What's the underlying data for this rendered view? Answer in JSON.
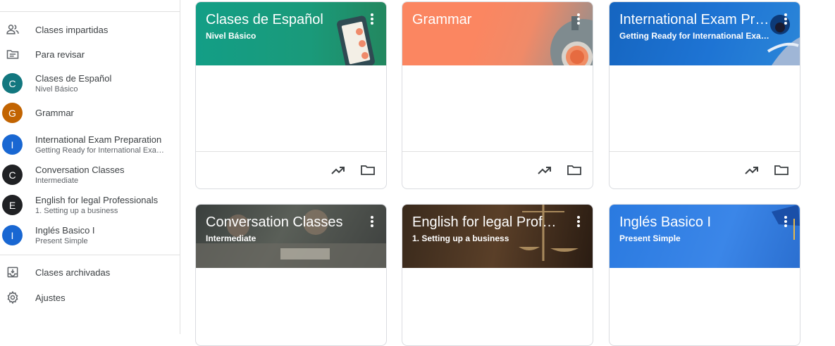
{
  "sidebar": {
    "nav_top": [
      {
        "label": "Clases impartidas",
        "icon": "people-icon"
      },
      {
        "label": "Para revisar",
        "icon": "review-folder-icon"
      }
    ],
    "courses": [
      {
        "initial": "C",
        "name": "Clases de Español",
        "section": "Nivel Básico",
        "color": "#12777f"
      },
      {
        "initial": "G",
        "name": "Grammar",
        "section": "",
        "color": "#c26401"
      },
      {
        "initial": "I",
        "name": "International Exam Preparation",
        "section": "Getting Ready for International Exams!",
        "color": "#1967d2"
      },
      {
        "initial": "C",
        "name": "Conversation Classes",
        "section": "Intermediate",
        "color": "#202124"
      },
      {
        "initial": "E",
        "name": "English for legal Professionals",
        "section": "1. Setting up a business",
        "color": "#202124"
      },
      {
        "initial": "I",
        "name": "Inglés Basico I",
        "section": "Present Simple",
        "color": "#1967d2"
      }
    ],
    "nav_bottom": [
      {
        "label": "Clases archivadas",
        "icon": "archive-icon"
      },
      {
        "label": "Ajustes",
        "icon": "settings-icon"
      }
    ]
  },
  "cards": [
    {
      "title": "Clases de Español",
      "section": "Nivel Básico",
      "theme": "teal-phone"
    },
    {
      "title": "Grammar",
      "section": "",
      "theme": "salmon-coffee"
    },
    {
      "title": "International Exam Preparation",
      "section": "Getting Ready for International Exams!",
      "theme": "blue-ink"
    },
    {
      "title": "Conversation Classes",
      "section": "Intermediate",
      "theme": "dark-photo-meeting"
    },
    {
      "title": "English for legal Professionals",
      "section": "1. Setting up a business",
      "theme": "dark-photo-scales"
    },
    {
      "title": "Inglés Basico I",
      "section": "Present Simple",
      "theme": "blue-cap"
    }
  ],
  "card_actions": {
    "trending_icon": "trending-up-icon",
    "folder_icon": "folder-icon"
  },
  "colors": {
    "teal": "#1b9a7c",
    "salmon": "#ff8a65",
    "blue": "#1e74d4",
    "border": "#dadce0"
  }
}
